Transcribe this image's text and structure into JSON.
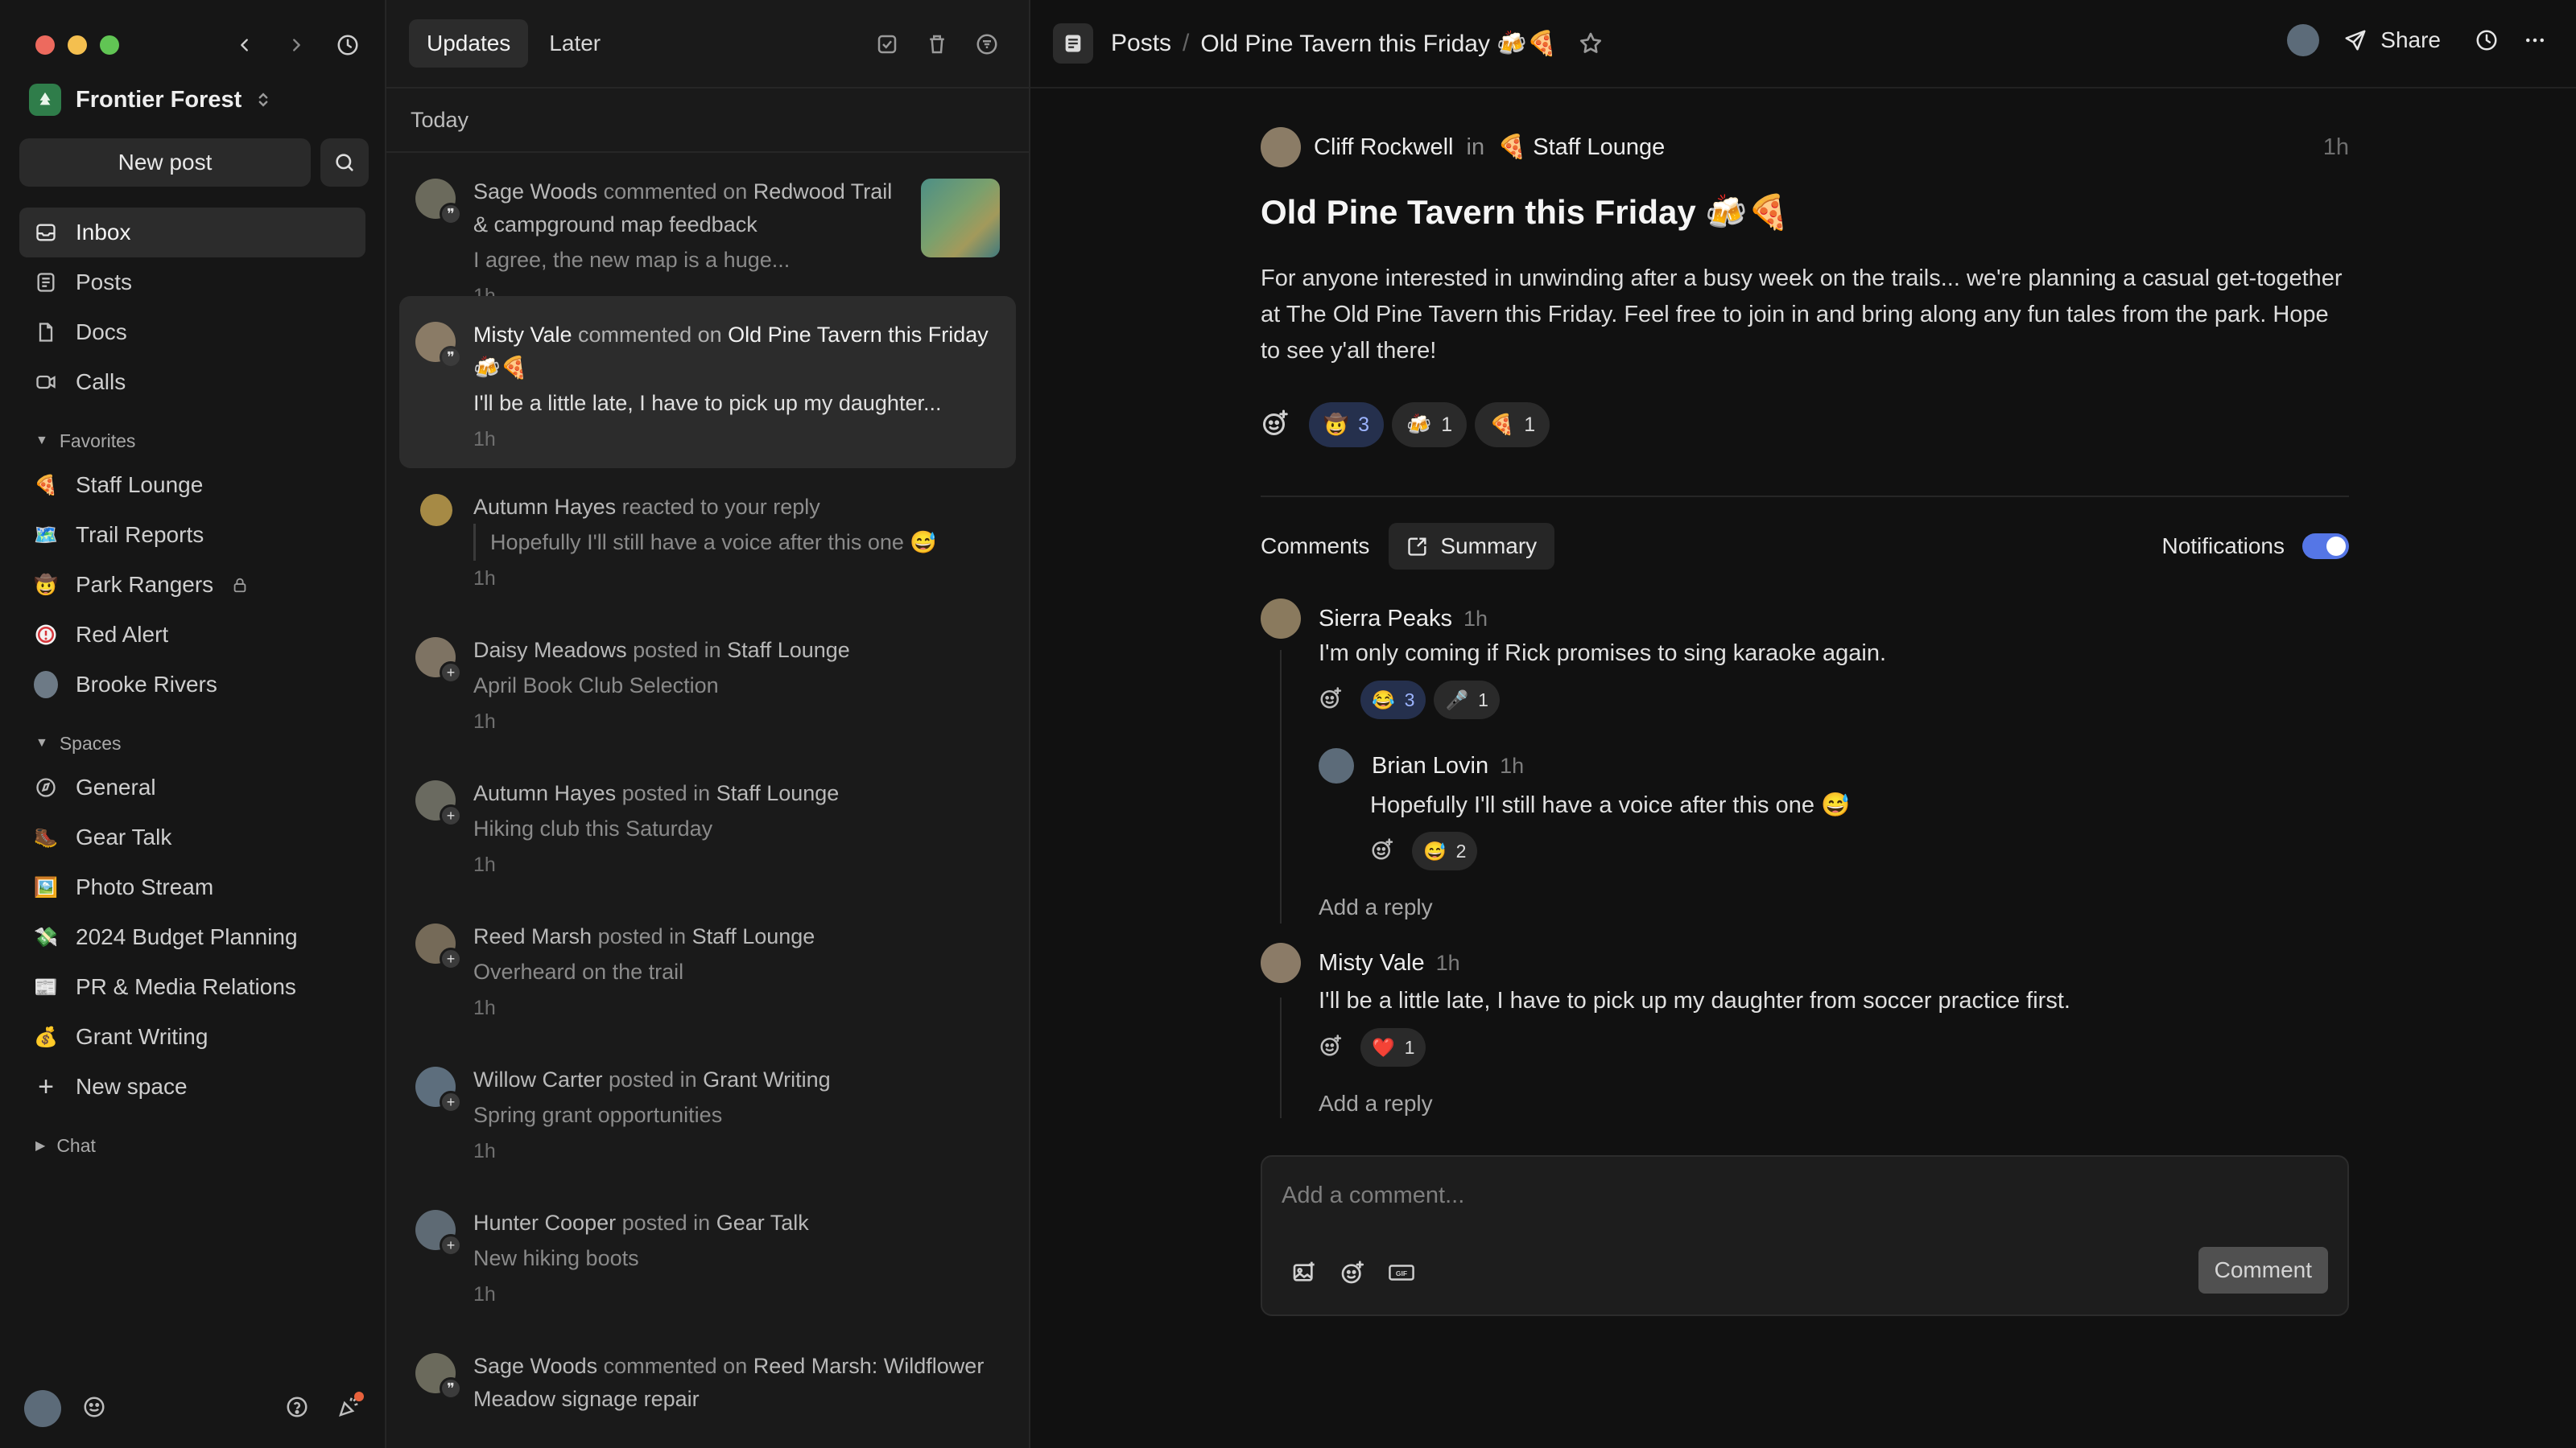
{
  "window": {
    "traffic_colors": [
      "#ed6a5e",
      "#f4bf4f",
      "#61c554"
    ]
  },
  "sidebar": {
    "org_name": "Frontier Forest",
    "new_post_label": "New post",
    "nav": [
      {
        "label": "Inbox",
        "icon": "inbox-icon"
      },
      {
        "label": "Posts",
        "icon": "posts-icon"
      },
      {
        "label": "Docs",
        "icon": "docs-icon"
      },
      {
        "label": "Calls",
        "icon": "calls-icon"
      }
    ],
    "favorites_title": "Favorites",
    "favorites": [
      {
        "label": "Staff Lounge",
        "emoji": "🍕"
      },
      {
        "label": "Trail Reports",
        "emoji": "🗺️"
      },
      {
        "label": "Park Rangers",
        "emoji": "🤠"
      },
      {
        "label": "Red Alert",
        "emoji": "🚨"
      },
      {
        "label": "Brooke Rivers",
        "emoji": "👤"
      }
    ],
    "spaces_title": "Spaces",
    "spaces": [
      {
        "label": "General",
        "emoji": "🧭"
      },
      {
        "label": "Gear Talk",
        "emoji": "🥾"
      },
      {
        "label": "Photo Stream",
        "emoji": "🖼️"
      },
      {
        "label": "2024 Budget Planning",
        "emoji": "💸"
      },
      {
        "label": "PR & Media Relations",
        "emoji": "📰"
      },
      {
        "label": "Grant Writing",
        "emoji": "💰"
      },
      {
        "label": "New space",
        "emoji": "+"
      }
    ],
    "chat_title": "Chat"
  },
  "inbox": {
    "tabs": [
      "Updates",
      "Later"
    ],
    "section": "Today",
    "items": [
      {
        "actor": "Sage Woods",
        "verb": " commented on ",
        "target": "Redwood Trail & campground map feedback",
        "preview": "I agree, the new map is a huge...",
        "time": "1h",
        "badge": "comment"
      },
      {
        "actor": "Misty Vale",
        "verb": " commented on ",
        "target": "Old Pine Tavern this Friday 🍻🍕",
        "preview": "I'll be a little late, I have to pick up my daughter...",
        "time": "1h",
        "badge": "comment"
      },
      {
        "actor": "Autumn Hayes",
        "verb": " reacted to your reply",
        "target": "",
        "preview": "Hopefully I'll still have a voice after this one 😅",
        "time": "1h",
        "badge": ""
      },
      {
        "actor": "Daisy Meadows",
        "verb": " posted in ",
        "target": "Staff Lounge",
        "preview": "April Book Club Selection",
        "time": "1h",
        "badge": "plus"
      },
      {
        "actor": "Autumn Hayes",
        "verb": " posted in ",
        "target": "Staff Lounge",
        "preview": "Hiking club this Saturday",
        "time": "1h",
        "badge": "plus"
      },
      {
        "actor": "Reed Marsh",
        "verb": " posted in ",
        "target": "Staff Lounge",
        "preview": "Overheard on the trail",
        "time": "1h",
        "badge": "plus"
      },
      {
        "actor": "Willow Carter",
        "verb": " posted in ",
        "target": "Grant Writing",
        "preview": "Spring grant opportunities",
        "time": "1h",
        "badge": "plus"
      },
      {
        "actor": "Hunter Cooper",
        "verb": " posted in ",
        "target": "Gear Talk",
        "preview": "New hiking boots",
        "time": "1h",
        "badge": "plus"
      },
      {
        "actor": "Sage Woods",
        "verb": " commented on ",
        "target": "Reed Marsh: Wildflower Meadow signage repair",
        "preview": "",
        "time": "",
        "badge": "comment"
      }
    ]
  },
  "header": {
    "crumb_root": "Posts",
    "crumb_sep": "/",
    "crumb_current": "Old Pine Tavern this Friday 🍻🍕",
    "share_label": "Share"
  },
  "post": {
    "author": "Cliff Rockwell",
    "in_word": "in",
    "space": "🍕 Staff Lounge",
    "time": "1h",
    "title": "Old Pine Tavern this Friday 🍻🍕",
    "body": "For anyone interested in unwinding after a busy week on the trails... we're planning a casual get-together at The Old Pine Tavern this Friday. Feel free to join in and bring along any fun tales from the park. Hope to see y'all there!",
    "reactions": [
      {
        "emoji": "🤠",
        "count": "3",
        "mine": true
      },
      {
        "emoji": "🍻",
        "count": "1",
        "mine": false
      },
      {
        "emoji": "🍕",
        "count": "1",
        "mine": false
      }
    ]
  },
  "comments": {
    "title": "Comments",
    "summary_label": "Summary",
    "notifications_label": "Notifications",
    "notifications_on": true,
    "list": [
      {
        "name": "Sierra Peaks",
        "time": "1h",
        "text": "I'm only coming if Rick promises to sing karaoke again.",
        "reactions": [
          {
            "emoji": "😂",
            "count": "3",
            "mine": true
          },
          {
            "emoji": "🎤",
            "count": "1",
            "mine": false
          }
        ]
      },
      {
        "name": "Brian Lovin",
        "time": "1h",
        "text": "Hopefully I'll still have a voice after this one 😅",
        "reactions": [
          {
            "emoji": "😅",
            "count": "2",
            "mine": false
          }
        ]
      },
      {
        "name": "Misty Vale",
        "time": "1h",
        "text": "I'll be a little late, I have to pick up my daughter from soccer practice first.",
        "reactions": [
          {
            "emoji": "❤️",
            "count": "1",
            "mine": false
          }
        ]
      }
    ],
    "add_reply_label": "Add a reply",
    "input_placeholder": "Add a comment...",
    "submit_label": "Comment"
  }
}
